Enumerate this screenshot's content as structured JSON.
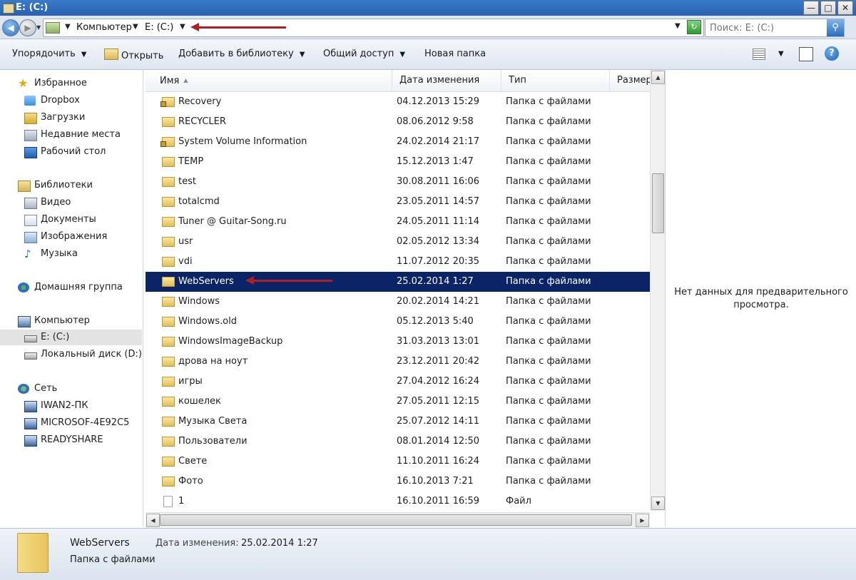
{
  "window": {
    "title": "E: (C:)",
    "minimize": "—",
    "maximize": "□",
    "close": "✕"
  },
  "address": {
    "crumbs": [
      "Компьютер",
      "E: (C:)"
    ],
    "search_placeholder": "Поиск: E: (C:)"
  },
  "toolbar": {
    "organize": "Упорядочить",
    "open": "Открыть",
    "add_library": "Добавить в библиотеку",
    "share": "Общий доступ",
    "new_folder": "Новая папка"
  },
  "sidebar": {
    "favorites": {
      "label": "Избранное",
      "items": [
        "Dropbox",
        "Загрузки",
        "Недавние места",
        "Рабочий стол"
      ]
    },
    "libraries": {
      "label": "Библиотеки",
      "items": [
        "Видео",
        "Документы",
        "Изображения",
        "Музыка"
      ]
    },
    "homegroup": {
      "label": "Домашняя группа"
    },
    "computer": {
      "label": "Компьютер",
      "items": [
        "E: (C:)",
        "Локальный диск (D:)"
      ]
    },
    "network": {
      "label": "Сеть",
      "items": [
        "IWAN2-ПК",
        "MICROSOF-4E92C5",
        "READYSHARE"
      ]
    }
  },
  "columns": {
    "name": "Имя",
    "date": "Дата изменения",
    "type": "Тип",
    "size": "Размер"
  },
  "files": [
    {
      "name": "Recovery",
      "date": "04.12.2013 15:29",
      "type": "Папка с файлами"
    },
    {
      "name": "RECYCLER",
      "date": "08.06.2012 9:58",
      "type": "Папка с файлами"
    },
    {
      "name": "System Volume Information",
      "date": "24.02.2014 21:17",
      "type": "Папка с файлами"
    },
    {
      "name": "TEMP",
      "date": "15.12.2013 1:47",
      "type": "Папка с файлами"
    },
    {
      "name": "test",
      "date": "30.08.2011 16:06",
      "type": "Папка с файлами"
    },
    {
      "name": "totalcmd",
      "date": "23.05.2011 14:57",
      "type": "Папка с файлами"
    },
    {
      "name": "Tuner @ Guitar-Song.ru",
      "date": "24.05.2011 11:14",
      "type": "Папка с файлами"
    },
    {
      "name": "usr",
      "date": "02.05.2012 13:34",
      "type": "Папка с файлами"
    },
    {
      "name": "vdi",
      "date": "11.07.2012 20:35",
      "type": "Папка с файлами"
    },
    {
      "name": "WebServers",
      "date": "25.02.2014 1:27",
      "type": "Папка с файлами"
    },
    {
      "name": "Windows",
      "date": "20.02.2014 14:21",
      "type": "Папка с файлами"
    },
    {
      "name": "Windows.old",
      "date": "05.12.2013 5:40",
      "type": "Папка с файлами"
    },
    {
      "name": "WindowsImageBackup",
      "date": "31.03.2013 13:01",
      "type": "Папка с файлами"
    },
    {
      "name": "дрова на ноут",
      "date": "23.12.2011 20:42",
      "type": "Папка с файлами"
    },
    {
      "name": "игры",
      "date": "27.04.2012 16:24",
      "type": "Папка с файлами"
    },
    {
      "name": "кошелек",
      "date": "27.05.2011 12:15",
      "type": "Папка с файлами"
    },
    {
      "name": "Музыка Света",
      "date": "25.07.2012 14:11",
      "type": "Папка с файлами"
    },
    {
      "name": "Пользователи",
      "date": "08.01.2014 12:50",
      "type": "Папка с файлами"
    },
    {
      "name": "Свете",
      "date": "11.10.2011 16:24",
      "type": "Папка с файлами"
    },
    {
      "name": "Фото",
      "date": "16.10.2013 7:21",
      "type": "Папка с файлами"
    },
    {
      "name": "1",
      "date": "16.10.2011 16:59",
      "type": "Файл"
    }
  ],
  "preview": {
    "message_line1": "Нет данных для предварительного",
    "message_line2": "просмотра."
  },
  "details": {
    "name": "WebServers",
    "type": "Папка с файлами",
    "modified_label": "Дата изменения:",
    "modified_value": "25.02.2014 1:27"
  }
}
